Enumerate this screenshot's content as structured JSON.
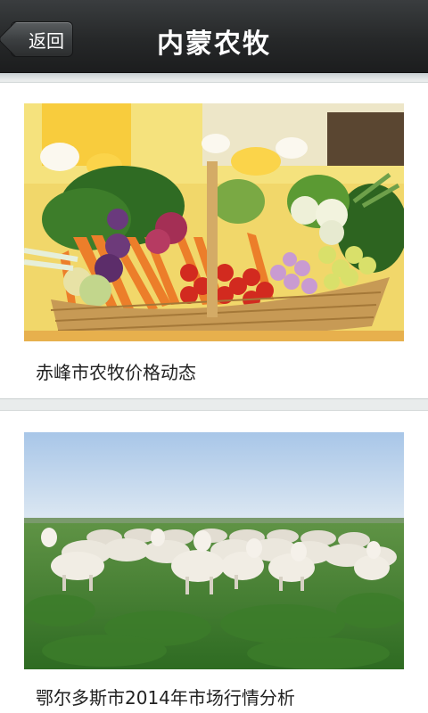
{
  "header": {
    "back_label": "返回",
    "title": "内蒙农牧"
  },
  "articles": [
    {
      "title": "赤峰市农牧价格动态",
      "image": "vegetable-basket-photo"
    },
    {
      "title": "鄂尔多斯市2014年市场行情分析",
      "image": "sheep-pasture-photo"
    }
  ],
  "colors": {
    "header_bg": "#262829",
    "page_bg": "#e9ecec",
    "card_bg": "#ffffff",
    "title_text": "#ffffff",
    "caption_text": "#222222"
  }
}
